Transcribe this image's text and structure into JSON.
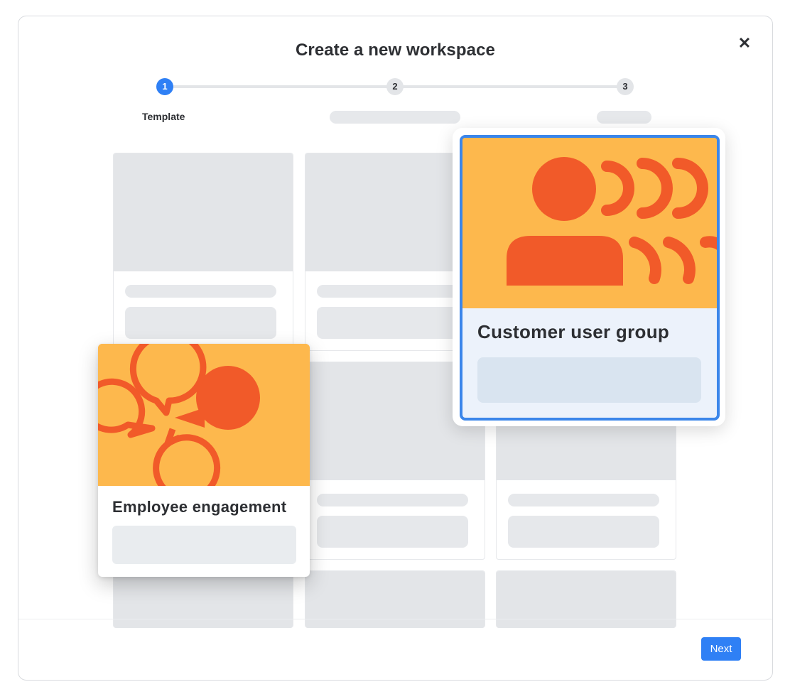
{
  "modal": {
    "title": "Create a new workspace",
    "close_icon": "close-icon",
    "close_label": "✕"
  },
  "stepper": {
    "steps": [
      {
        "number": "1",
        "label": "Template",
        "active": true
      },
      {
        "number": "2",
        "label": "",
        "active": false
      },
      {
        "number": "3",
        "label": "",
        "active": false
      }
    ]
  },
  "templates": {
    "employee_engagement": {
      "title": "Employee engagement",
      "icon": "speech-bubbles-icon"
    },
    "customer_user_group": {
      "title": "Customer user group",
      "icon": "person-broadcast-icon"
    }
  },
  "footer": {
    "next_label": "Next"
  },
  "colors": {
    "accent": "#2f80f5",
    "selected_border": "#3b86ea",
    "art_background": "#fdb84d",
    "art_foreground": "#f15a29",
    "skeleton": "#e3e5e8"
  }
}
